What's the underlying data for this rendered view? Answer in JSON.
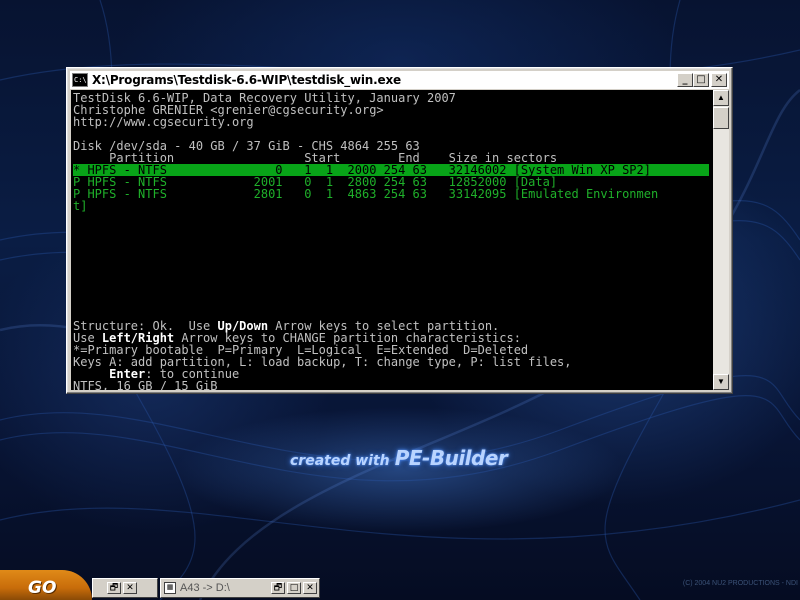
{
  "window": {
    "title": "X:\\Programs\\Testdisk-6.6-WIP\\testdisk_win.exe",
    "app_icon_text": "C:\\",
    "buttons": {
      "minimize": "_",
      "maximize": "□",
      "close": "✕"
    }
  },
  "console": {
    "header": [
      "TestDisk 6.6-WIP, Data Recovery Utility, January 2007",
      "Christophe GRENIER <grenier@cgsecurity.org>",
      "http://www.cgsecurity.org"
    ],
    "disk_line": "Disk /dev/sda - 40 GB / 37 GiB - CHS 4864 255 63",
    "columns_line": "     Partition                  Start        End    Size in sectors",
    "rows": [
      "* HPFS - NTFS               0   1  1  2000 254 63   32146002 [System Win XP SP2]",
      "P HPFS - NTFS            2001   0  1  2800 254 63   12852000 [Data]",
      "P HPFS - NTFS            2801   0  1  4863 254 63   33142095 [Emulated Environmen",
      "t]"
    ],
    "footer": {
      "line1_pre": "Structure: Ok.  Use ",
      "line1_bold": "Up/Down",
      "line1_post": " Arrow keys to select partition.",
      "line2_pre": "Use ",
      "line2_bold": "Left/Right",
      "line2_post": " Arrow keys to CHANGE partition characteristics:",
      "line3": "*=Primary bootable  P=Primary  L=Logical  E=Extended  D=Deleted",
      "line4": "Keys A: add partition, L: load backup, T: change type, P: list files,",
      "line5_pad": "     ",
      "line5_bold": "Enter",
      "line5_post": ": to continue",
      "line6": "NTFS, 16 GB / 15 GiB"
    }
  },
  "scrollbar": {
    "up_arrow": "▲",
    "down_arrow": "▼"
  },
  "branding": {
    "small": "created with",
    "big": "PE-Builder"
  },
  "taskbar": {
    "go_label": "GO",
    "task1_buttons": [
      "🗗",
      "✕"
    ],
    "task2_label": "A43 -> D:\\",
    "task2_buttons": [
      "🗗",
      "□",
      "✕"
    ],
    "copyright": "(C) 2004 NU2 PRODUCTIONS - NDI"
  },
  "colors": {
    "highlight": "#08a418",
    "console_text": "#c0c0c0",
    "green_text": "#1fb02a"
  }
}
